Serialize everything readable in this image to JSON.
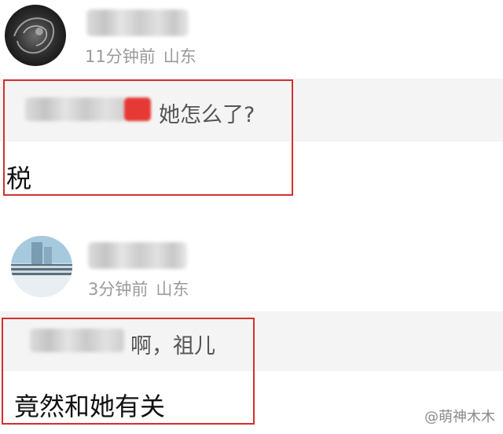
{
  "comments": [
    {
      "time": "11分钟前",
      "location": "山东",
      "quote": "她怎么了?",
      "reply": "税"
    },
    {
      "time": "3分钟前",
      "location": "山东",
      "quote": "啊，祖儿",
      "reply": "竟然和她有关"
    }
  ],
  "watermark": "@萌神木木",
  "colors": {
    "highlight_frame": "#d32f2f",
    "quote_background": "#f4f4f4",
    "meta_text": "#9a9a9a"
  }
}
